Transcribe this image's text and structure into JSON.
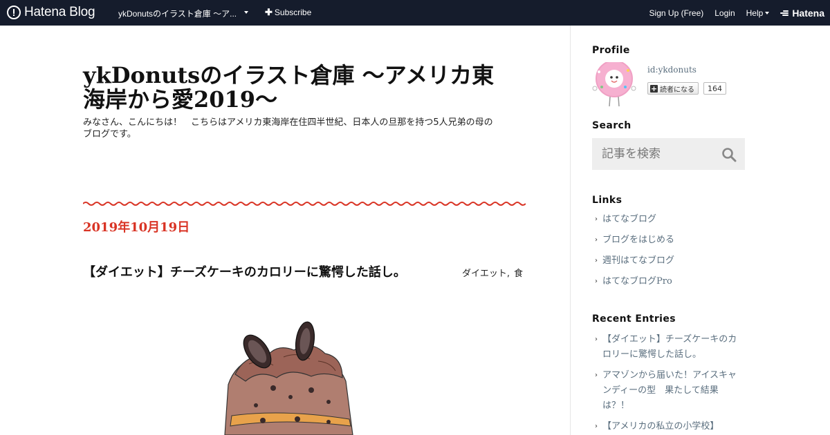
{
  "navbar": {
    "logo_text": "Hatena Blog",
    "blog_title": "ykDonutsのイラスト倉庫 ～ア...",
    "subscribe_label": "Subscribe",
    "signup_label": "Sign Up (Free)",
    "login_label": "Login",
    "help_label": "Help",
    "brand_label": "Hatena",
    "bg_color": "#151c2c"
  },
  "blog": {
    "title": "ykDonutsのイラスト倉庫 ～アメリカ東海岸から愛2019～",
    "description": "みなさん、こんにちは！　こちらはアメリカ東海岸在住四半世紀、日本人の旦那を持つ5人兄弟の母のブログです。"
  },
  "entry": {
    "date": "2019年10月19日",
    "title": "【ダイエット】チーズケーキのカロリーに驚愕した話し。",
    "categories": [
      "ダイエット",
      "食"
    ],
    "image_icon": "cookies-and-cream-cake-illustration",
    "date_color": "#d93425"
  },
  "sidebar": {
    "profile_heading": "Profile",
    "profile_id": "id:ykdonuts",
    "reader_button_label": "読者になる",
    "reader_count": "164",
    "search_heading": "Search",
    "search_placeholder": "記事を検索",
    "links_heading": "Links",
    "links": [
      "はてなブログ",
      "ブログをはじめる",
      "週刊はてなブログ",
      "はてなブログPro"
    ],
    "recent_heading": "Recent Entries",
    "recent_entries": [
      "【ダイエット】チーズケーキのカロリーに驚愕した話し。",
      "アマゾンから届いた！アイスキャンディーの型　果たして結果は？！",
      "【アメリカの私立の小学校】"
    ],
    "link_color": "#5a6e7e"
  }
}
